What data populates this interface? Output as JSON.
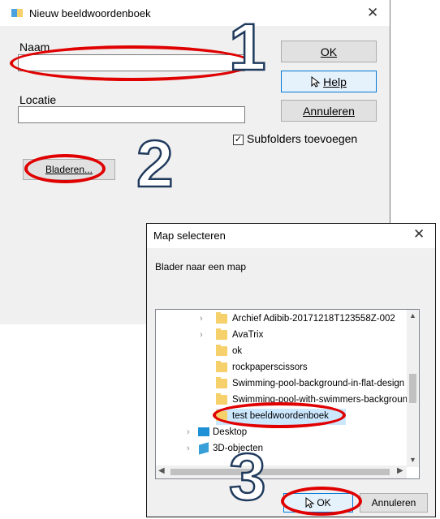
{
  "dialog_new": {
    "title": "Nieuw beeldwoordenboek",
    "close": "✕",
    "name_label": "Naam",
    "name_value": "",
    "location_label": "Locatie",
    "location_value": "",
    "ok": "OK",
    "help": "Help",
    "cancel": "Annuleren",
    "subfolders_label": "Subfolders toevoegen",
    "subfolders_checked": true,
    "browse": "Bladeren..."
  },
  "dialog_folder": {
    "title": "Map selecteren",
    "close": "✕",
    "instruction": "Blader naar een map",
    "tree_items": [
      {
        "label": "Archief Adibib-20171218T123558Z-002",
        "expandable": true,
        "type": "folder"
      },
      {
        "label": "AvaTrix",
        "expandable": true,
        "type": "folder"
      },
      {
        "label": "ok",
        "expandable": false,
        "type": "folder"
      },
      {
        "label": "rockpaperscissors",
        "expandable": false,
        "type": "folder"
      },
      {
        "label": "Swimming-pool-background-in-flat-design",
        "expandable": false,
        "type": "folder"
      },
      {
        "label": "Swimming-pool-with-swimmers-background",
        "expandable": false,
        "type": "folder"
      },
      {
        "label": "test beeldwoordenboek",
        "expandable": false,
        "type": "folder",
        "selected": true
      },
      {
        "label": "Desktop",
        "expandable": true,
        "type": "desktop"
      },
      {
        "label": "3D-objecten",
        "expandable": true,
        "type": "3d"
      }
    ],
    "ok": "OK",
    "cancel": "Annuleren"
  },
  "annotations": {
    "step1": "1",
    "step2": "2",
    "step3": "3",
    "color": "#e00000"
  },
  "colors": {
    "selection": "#cce8ff",
    "focus_border": "#0078d7",
    "folder": "#f5d06b"
  }
}
